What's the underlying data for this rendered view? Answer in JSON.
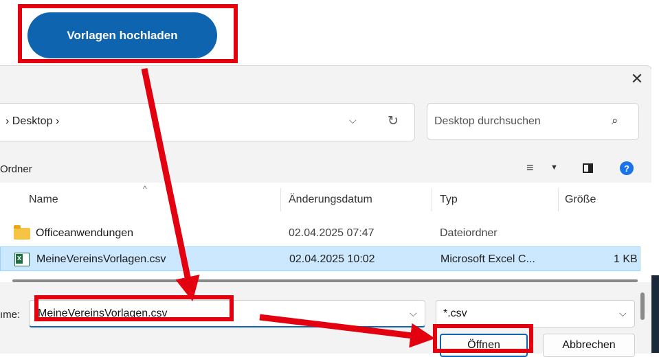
{
  "upload": {
    "button_label": "Vorlagen hochladen"
  },
  "dialog": {
    "close_icon": "close-icon",
    "address": {
      "crumb_prefix": "›",
      "crumb": "Desktop",
      "crumb_suffix": "›",
      "dropdown": "⌵",
      "refresh": "↻"
    },
    "search": {
      "placeholder": "Desktop durchsuchen",
      "icon": "⌕"
    },
    "toolbar": {
      "label": "Ordner",
      "view_icon": "≡",
      "caret": "▼",
      "help": "?"
    },
    "columns": {
      "name": "Name",
      "modified": "Änderungsdatum",
      "type": "Typ",
      "size": "Größe",
      "sort_caret": "^"
    },
    "rows": [
      {
        "name": "Officeanwendungen",
        "modified": "02.04.2025 07:47",
        "type": "Dateiordner",
        "size": ""
      },
      {
        "name": "MeineVereinsVorlagen.csv",
        "modified": "02.04.2025 10:02",
        "type": "Microsoft Excel C...",
        "size": "1 KB"
      }
    ],
    "filename": {
      "label": "ıme:",
      "value": "MeineVereinsVorlagen.csv",
      "dropdown": "⌵"
    },
    "filetype": {
      "value": "*.csv",
      "dropdown": "⌵"
    },
    "buttons": {
      "open": "Öffnen",
      "cancel": "Abbrechen"
    }
  },
  "colors": {
    "accent": "#0f64b0",
    "highlight": "#e3000f",
    "selection": "#cce8ff"
  }
}
